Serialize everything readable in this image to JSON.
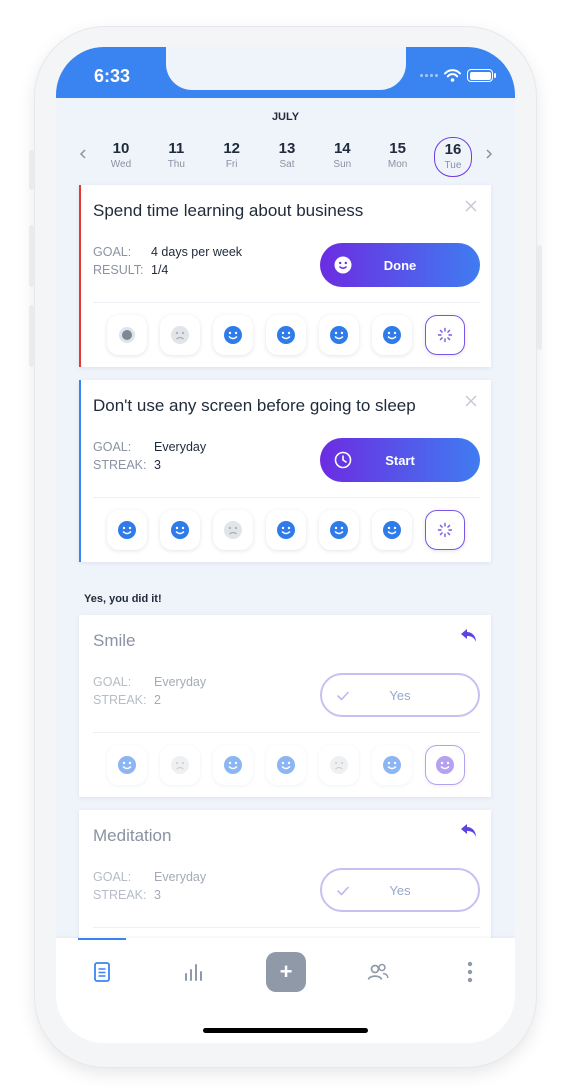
{
  "status_bar": {
    "time": "6:33"
  },
  "calendar": {
    "month": "JULY",
    "prev_icon": "chevron-left-icon",
    "next_icon": "chevron-right-icon",
    "days": [
      {
        "num": "10",
        "name": "Wed"
      },
      {
        "num": "11",
        "name": "Thu"
      },
      {
        "num": "12",
        "name": "Fri"
      },
      {
        "num": "13",
        "name": "Sat"
      },
      {
        "num": "14",
        "name": "Sun"
      },
      {
        "num": "15",
        "name": "Mon"
      },
      {
        "num": "16",
        "name": "Tue",
        "selected": true
      }
    ]
  },
  "habits": [
    {
      "title": "Spend time learning about business",
      "goal_label": "GOAL:",
      "goal_value": "4 days per week",
      "stat_label": "RESULT:",
      "stat_value": "1/4",
      "action_label": "Done",
      "action_icon": "smile-icon",
      "accent_color": "#e53935",
      "faces": [
        "dot",
        "sad",
        "happy",
        "happy",
        "happy",
        "happy",
        "loading"
      ]
    },
    {
      "title": "Don't use any screen before going to sleep",
      "goal_label": "GOAL:",
      "goal_value": "Everyday",
      "stat_label": "STREAK:",
      "stat_value": "3",
      "action_label": "Start",
      "action_icon": "clock-icon",
      "accent_color": "#3a84f2",
      "faces": [
        "happy",
        "happy",
        "sad",
        "happy",
        "happy",
        "happy",
        "loading"
      ]
    }
  ],
  "completed_section": {
    "label": "Yes, you did it!"
  },
  "completed": [
    {
      "title": "Smile",
      "goal_label": "GOAL:",
      "goal_value": "Everyday",
      "stat_label": "STREAK:",
      "stat_value": "2",
      "action_label": "Yes",
      "faces": [
        "happy",
        "sad",
        "happy",
        "happy",
        "sad",
        "happy",
        "purple"
      ]
    },
    {
      "title": "Meditation",
      "goal_label": "GOAL:",
      "goal_value": "Everyday",
      "stat_label": "STREAK:",
      "stat_value": "3",
      "action_label": "Yes"
    }
  ],
  "tabbar": {
    "items": [
      "document-icon",
      "bar-chart-icon",
      "add-icon",
      "users-icon",
      "more-vertical-icon"
    ],
    "add_label": "+"
  },
  "colors": {
    "accent_blue": "#3a84f2",
    "accent_purple": "#6c2ce2",
    "accent_red": "#e53935"
  }
}
